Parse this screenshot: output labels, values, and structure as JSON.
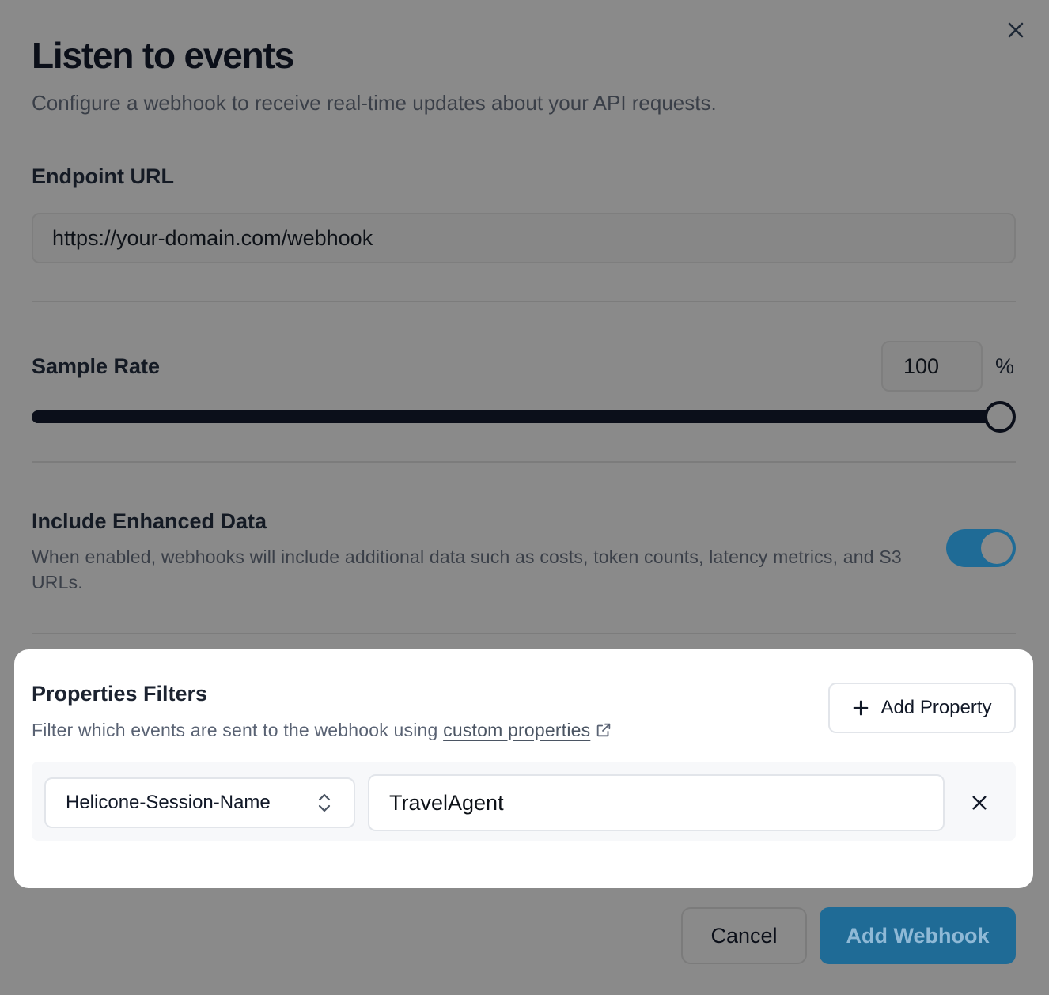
{
  "dialog": {
    "title": "Listen to events",
    "subtitle": "Configure a webhook to receive real-time updates about your API requests.",
    "close_icon": "close-icon"
  },
  "endpoint": {
    "label": "Endpoint URL",
    "value": "https://your-domain.com/webhook"
  },
  "sample_rate": {
    "label": "Sample Rate",
    "value": "100",
    "unit": "%",
    "slider_fraction": 1.0
  },
  "enhanced_data": {
    "label": "Include Enhanced Data",
    "description": "When enabled, webhooks will include additional data such as costs, token counts, latency metrics, and S3 URLs.",
    "enabled": true
  },
  "filters": {
    "title": "Properties Filters",
    "description_prefix": "Filter which events are sent to the webhook using ",
    "link_text": "custom properties",
    "add_button_label": "Add Property",
    "rows": [
      {
        "property": "Helicone-Session-Name",
        "value": "TravelAgent"
      }
    ]
  },
  "footer": {
    "cancel_label": "Cancel",
    "submit_label": "Add Webhook"
  },
  "colors": {
    "accent": "#1f6b96",
    "track": "#0b0f1a"
  }
}
